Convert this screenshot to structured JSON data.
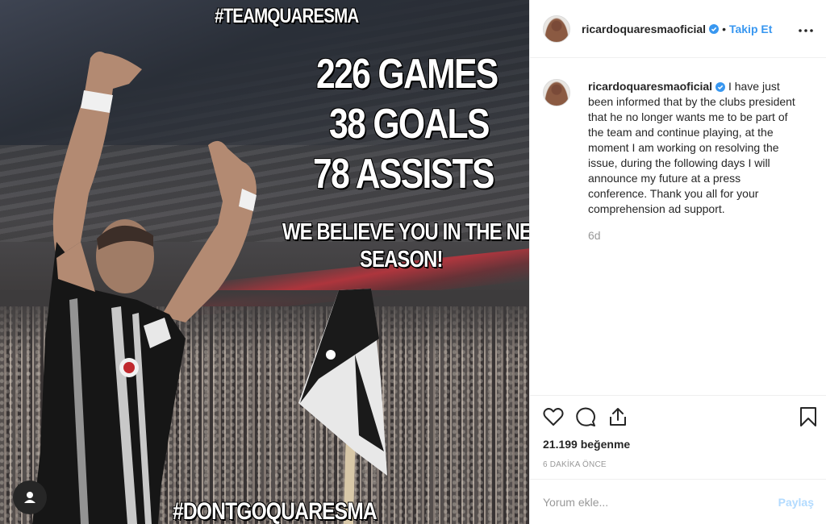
{
  "post": {
    "media_text": {
      "hashtag_top": "#TEAMQUARESMA",
      "stat_games": "226 GAMES",
      "stat_goals": "38 GOALS",
      "stat_assists": "78 ASSISTS",
      "believe_line1": "WE BELIEVE YOU IN THE NEW",
      "believe_line2": "SEASON!",
      "hashtag_bottom": "#DONTGOQUARESMA"
    }
  },
  "header": {
    "username": "ricardoquaresmaoficial",
    "separator": "•",
    "follow_label": "Takip Et",
    "more_icon": "more-horizontal-icon"
  },
  "caption": {
    "username": "ricardoquaresmaoficial",
    "text": "I have just been informed that by the clubs president that he no longer wants me to be part of the team and continue playing, at the moment I am working on resolving the issue, during the following days I will announce my future at a press conference. Thank you all for your comprehension ad support.",
    "time": "6d"
  },
  "actions": {
    "icons": [
      "heart-icon",
      "comment-icon",
      "share-icon",
      "bookmark-icon"
    ],
    "likes": "21.199 beğenme",
    "posted_ago": "6 DAKİKA ÖNCE"
  },
  "comment": {
    "placeholder": "Yorum ekle...",
    "share_label": "Paylaş"
  },
  "colors": {
    "accent": "#3897f0",
    "verified": "#3897f0",
    "muted": "#999999",
    "share_disabled": "#b3dbff"
  }
}
